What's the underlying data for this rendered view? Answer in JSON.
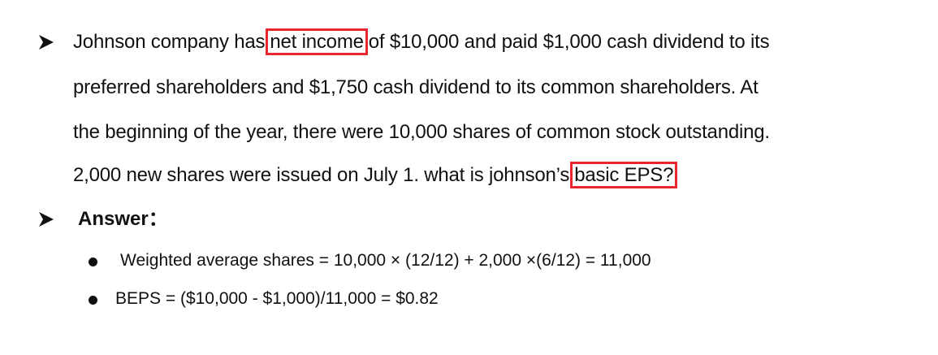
{
  "question": {
    "line1_pre": "Johnson company has",
    "line1_highlight": "net income",
    "line1_post": "of $10,000  and paid $1,000 cash dividend to its",
    "line2": "preferred shareholders and $1,750 cash dividend to its common shareholders. At",
    "line3": "the beginning of the year, there were 10,000 shares of common stock outstanding.",
    "line4_pre": "2,000 new shares were issued on July 1. what is johnson’s",
    "line4_highlight": "basic EPS?"
  },
  "answer": {
    "heading": "Answer：",
    "bullets": [
      "Weighted  average shares = 10,000 × (12/12) +  2,000 ×(6/12) = 11,000",
      "BEPS = ($10,000 - $1,000)/11,000 = $0.82"
    ]
  },
  "colors": {
    "highlight_border": "#e8262d",
    "text": "#111111"
  }
}
